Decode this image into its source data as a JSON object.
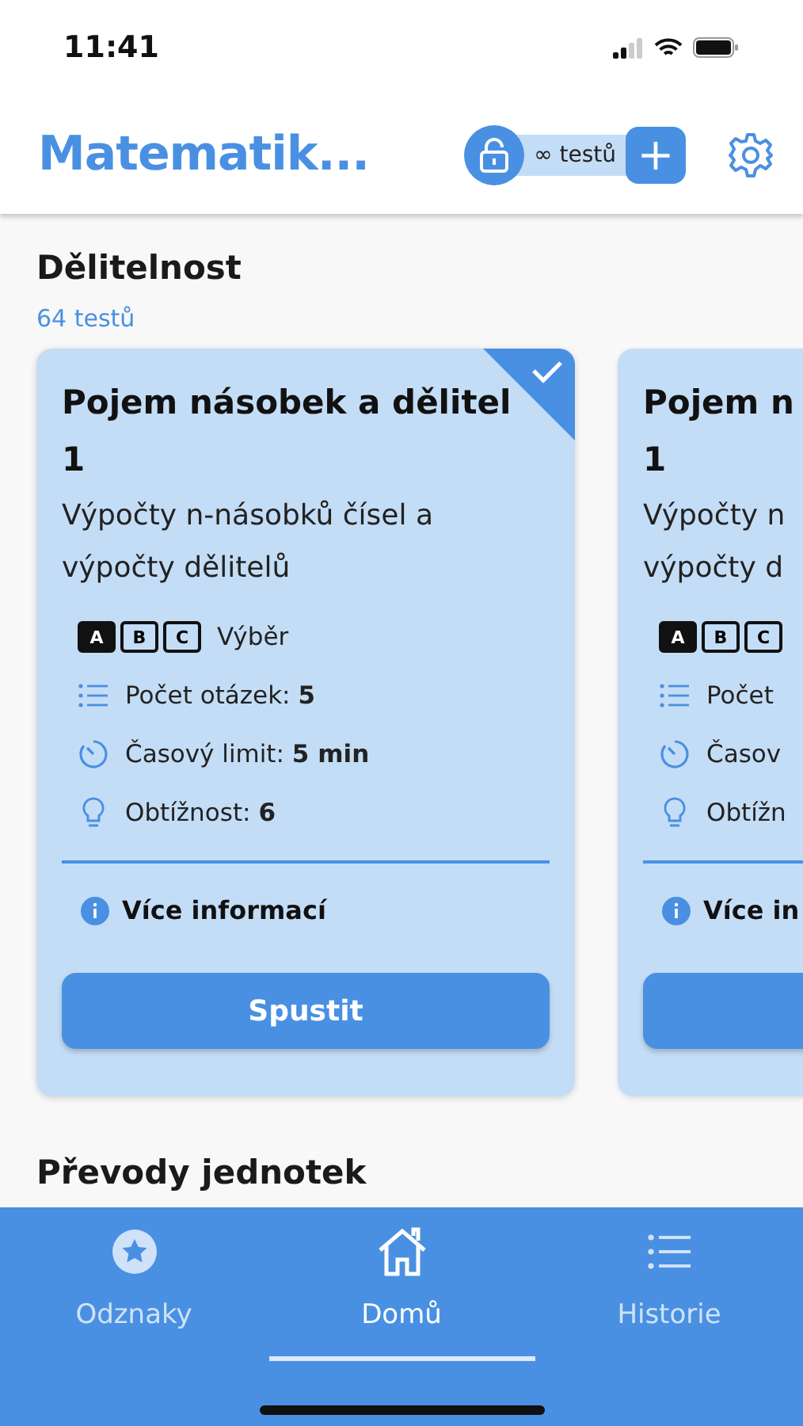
{
  "status_bar": {
    "time": "11:41"
  },
  "header": {
    "title": "Matematik...",
    "tests_badge": "∞ testů",
    "add_label": "+"
  },
  "sections": [
    {
      "title": "Dělitelnost",
      "count": "64 testů",
      "cards": [
        {
          "completed": true,
          "title_lines": [
            "Pojem násobek a dělitel",
            "1"
          ],
          "description_lines": [
            "Výpočty n-násobků čísel a",
            "výpočty dělitelů"
          ],
          "stats": [
            {
              "kind": "abc",
              "letters": [
                "A",
                "B",
                "C"
              ],
              "label": "Výběr"
            },
            {
              "kind": "questions",
              "label": "Počet otázek:",
              "value": "5"
            },
            {
              "kind": "time",
              "label": "Časový limit:",
              "value": "5 min"
            },
            {
              "kind": "difficulty",
              "label": "Obtížnost:",
              "value": "6"
            }
          ],
          "info": "Více informací",
          "button": "Spustit"
        },
        {
          "title_lines": [
            "Pojem n",
            "1"
          ],
          "description_lines": [
            "Výpočty n",
            "výpočty d"
          ],
          "stats": [
            {
              "kind": "abc",
              "letters": [
                "A",
                "B",
                "C"
              ]
            },
            {
              "kind": "questions",
              "label": "Počet"
            },
            {
              "kind": "time",
              "label": "Časov"
            },
            {
              "kind": "difficulty",
              "label": "Obtížn"
            }
          ],
          "info": "Více in"
        }
      ]
    },
    {
      "title": "Převody jednotek"
    }
  ],
  "tabs": [
    {
      "label": "Odznaky",
      "kind": "badges",
      "selected": false
    },
    {
      "label": "Domů",
      "kind": "home",
      "selected": true
    },
    {
      "label": "Historie",
      "kind": "history",
      "selected": false
    }
  ]
}
